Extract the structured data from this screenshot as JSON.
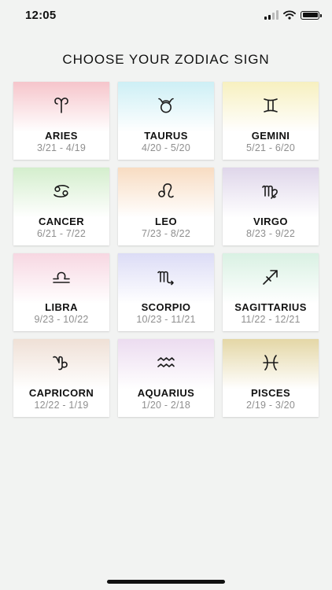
{
  "status_bar": {
    "time": "12:05",
    "icons": [
      "cellular-signal-icon",
      "wifi-icon",
      "battery-icon"
    ]
  },
  "title": "CHOOSE YOUR ZODIAC SIGN",
  "signs": [
    {
      "name": "ARIES",
      "dates": "3/21 - 4/19",
      "icon": "aries-icon",
      "color": "#f6c5cb"
    },
    {
      "name": "TAURUS",
      "dates": "4/20 - 5/20",
      "icon": "taurus-icon",
      "color": "#cdeff5"
    },
    {
      "name": "GEMINI",
      "dates": "5/21 - 6/20",
      "icon": "gemini-icon",
      "color": "#f7f0bf"
    },
    {
      "name": "CANCER",
      "dates": "6/21 - 7/22",
      "icon": "cancer-icon",
      "color": "#d4eecd"
    },
    {
      "name": "LEO",
      "dates": "7/23 - 8/22",
      "icon": "leo-icon",
      "color": "#f8dcc2"
    },
    {
      "name": "VIRGO",
      "dates": "8/23 - 9/22",
      "icon": "virgo-icon",
      "color": "#dfd6ea"
    },
    {
      "name": "LIBRA",
      "dates": "9/23 - 10/22",
      "icon": "libra-icon",
      "color": "#f7d7e2"
    },
    {
      "name": "SCORPIO",
      "dates": "10/23 - 11/21",
      "icon": "scorpio-icon",
      "color": "#dcdcf6"
    },
    {
      "name": "SAGITTARIUS",
      "dates": "11/22 - 12/21",
      "icon": "sagittarius-icon",
      "color": "#d9f1e3"
    },
    {
      "name": "CAPRICORN",
      "dates": "12/22 - 1/19",
      "icon": "capricorn-icon",
      "color": "#efe0d6"
    },
    {
      "name": "AQUARIUS",
      "dates": "1/20 - 2/18",
      "icon": "aquarius-icon",
      "color": "#ecdcf0"
    },
    {
      "name": "PISCES",
      "dates": "2/19 - 3/20",
      "icon": "pisces-icon",
      "color": "#e4d7a6"
    }
  ]
}
